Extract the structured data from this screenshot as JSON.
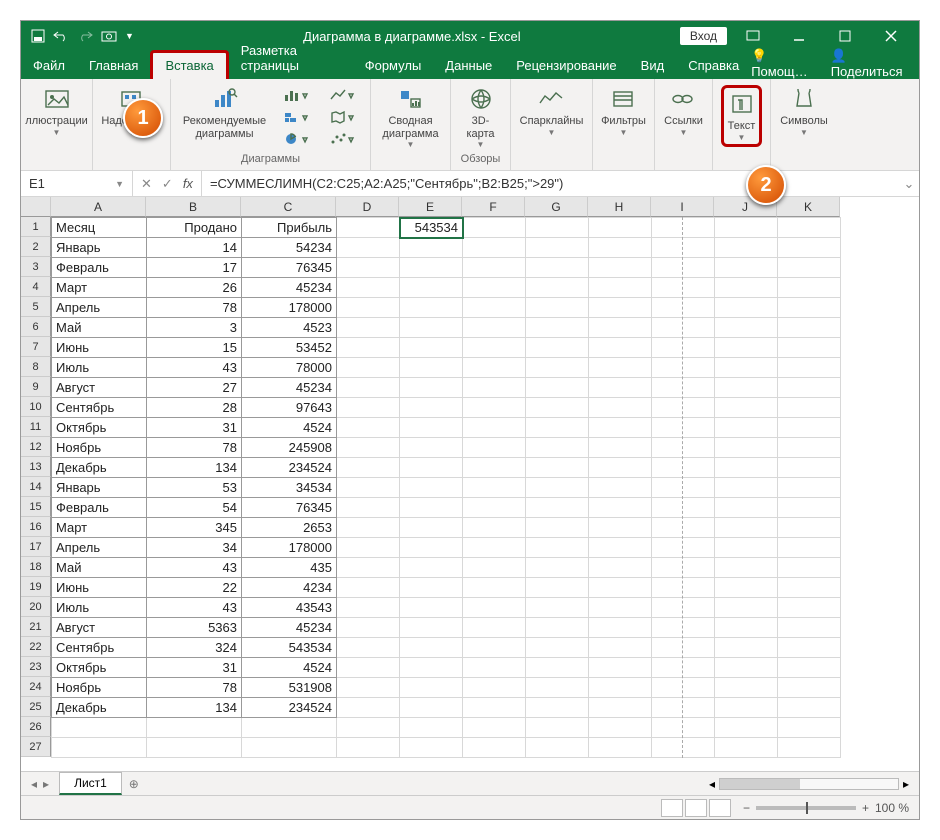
{
  "titlebar": {
    "doc_title": "Диаграмма в диаграмме.xlsx - Excel",
    "login": "Вход"
  },
  "tabs": {
    "file": "Файл",
    "home": "Главная",
    "insert": "Вставка",
    "layout": "Разметка страницы",
    "formulas": "Формулы",
    "data": "Данные",
    "review": "Рецензирование",
    "view": "Вид",
    "help": "Справка",
    "tell": "Помощ…",
    "share": "Поделиться"
  },
  "ribbon": {
    "illustrations": "ллюстрации",
    "addins": "Надстройки",
    "rec_charts": "Рекомендуемые диаграммы",
    "charts_group": "Диаграммы",
    "pivot_chart": "Сводная диаграмма",
    "map3d": "3D-карта",
    "tours_group": "Обзоры",
    "sparklines": "Спарклайны",
    "filters": "Фильтры",
    "links": "Ссылки",
    "text": "Текст",
    "symbols": "Символы"
  },
  "formula_bar": {
    "namebox": "E1",
    "formula": "=СУММЕСЛИМН(C2:C25;A2:A25;\"Сентябрь\";B2:B25;\">29\")"
  },
  "columns": [
    "A",
    "B",
    "C",
    "D",
    "E",
    "F",
    "G",
    "H",
    "I",
    "J",
    "K"
  ],
  "headers": {
    "A": "Месяц",
    "B": "Продано",
    "C": "Прибыль"
  },
  "cellE1": "543534",
  "rows": [
    {
      "n": 2,
      "a": "Январь",
      "b": "14",
      "c": "54234"
    },
    {
      "n": 3,
      "a": "Февраль",
      "b": "17",
      "c": "76345"
    },
    {
      "n": 4,
      "a": "Март",
      "b": "26",
      "c": "45234"
    },
    {
      "n": 5,
      "a": "Апрель",
      "b": "78",
      "c": "178000"
    },
    {
      "n": 6,
      "a": "Май",
      "b": "3",
      "c": "4523"
    },
    {
      "n": 7,
      "a": "Июнь",
      "b": "15",
      "c": "53452"
    },
    {
      "n": 8,
      "a": "Июль",
      "b": "43",
      "c": "78000"
    },
    {
      "n": 9,
      "a": "Август",
      "b": "27",
      "c": "45234"
    },
    {
      "n": 10,
      "a": "Сентябрь",
      "b": "28",
      "c": "97643"
    },
    {
      "n": 11,
      "a": "Октябрь",
      "b": "31",
      "c": "4524"
    },
    {
      "n": 12,
      "a": "Ноябрь",
      "b": "78",
      "c": "245908"
    },
    {
      "n": 13,
      "a": "Декабрь",
      "b": "134",
      "c": "234524"
    },
    {
      "n": 14,
      "a": "Январь",
      "b": "53",
      "c": "34534"
    },
    {
      "n": 15,
      "a": "Февраль",
      "b": "54",
      "c": "76345"
    },
    {
      "n": 16,
      "a": "Март",
      "b": "345",
      "c": "2653"
    },
    {
      "n": 17,
      "a": "Апрель",
      "b": "34",
      "c": "178000"
    },
    {
      "n": 18,
      "a": "Май",
      "b": "43",
      "c": "435"
    },
    {
      "n": 19,
      "a": "Июнь",
      "b": "22",
      "c": "4234"
    },
    {
      "n": 20,
      "a": "Июль",
      "b": "43",
      "c": "43543"
    },
    {
      "n": 21,
      "a": "Август",
      "b": "5363",
      "c": "45234"
    },
    {
      "n": 22,
      "a": "Сентябрь",
      "b": "324",
      "c": "543534"
    },
    {
      "n": 23,
      "a": "Октябрь",
      "b": "31",
      "c": "4524"
    },
    {
      "n": 24,
      "a": "Ноябрь",
      "b": "78",
      "c": "531908"
    },
    {
      "n": 25,
      "a": "Декабрь",
      "b": "134",
      "c": "234524"
    }
  ],
  "sheet_tab": "Лист1",
  "zoom": "100 %",
  "callouts": {
    "one": "1",
    "two": "2"
  }
}
